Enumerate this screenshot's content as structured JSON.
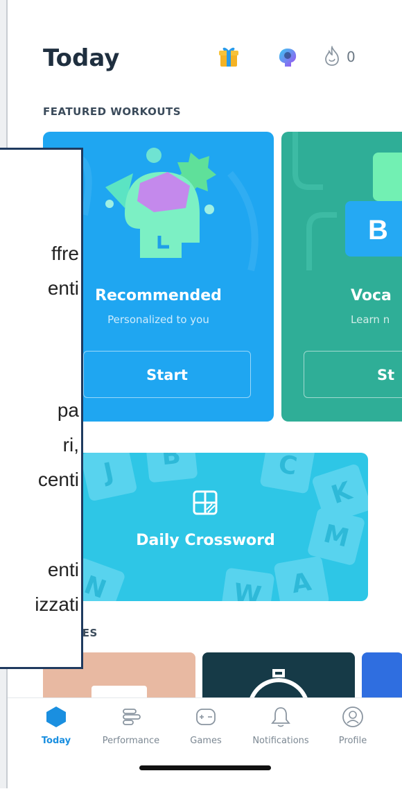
{
  "header": {
    "title": "Today",
    "streak_count": "0"
  },
  "icons": {
    "gift": "gift-icon",
    "brain": "brain-icon",
    "flame": "flame-icon"
  },
  "sections": {
    "featured": "FEATURED WORKOUTS",
    "games_partial": "T GAMES"
  },
  "cards": {
    "recommended": {
      "title": "Recommended",
      "subtitle": "Personalized to you",
      "button": "Start"
    },
    "vocabulary": {
      "title": "Voca",
      "subtitle": "Learn n",
      "button": "St"
    }
  },
  "daily": {
    "label": "Daily Crossword",
    "tiles": [
      "J",
      "C",
      "K",
      "M",
      "A",
      "B",
      "N",
      "W"
    ]
  },
  "tabs": [
    {
      "label": "Today",
      "icon": "hexagon-icon"
    },
    {
      "label": "Performance",
      "icon": "bars-icon"
    },
    {
      "label": "Games",
      "icon": "gamepad-icon"
    },
    {
      "label": "Notifications",
      "icon": "bell-icon"
    },
    {
      "label": "Profile",
      "icon": "profile-icon"
    }
  ],
  "overlay_text": [
    "ffre",
    "enti",
    "pa",
    "ri,",
    "centi",
    "enti",
    "izzati"
  ],
  "colors": {
    "accent": "#1a8fe0",
    "recommended": "#1fa6f1",
    "vocabulary": "#2fae97",
    "crossword": "#2ec6e6"
  }
}
